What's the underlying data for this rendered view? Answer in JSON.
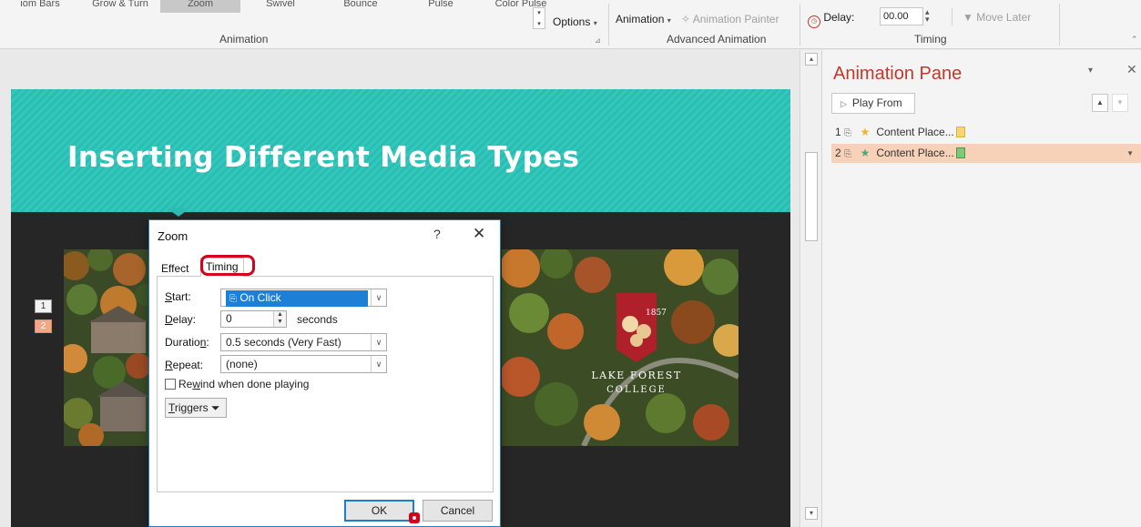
{
  "ribbon": {
    "gallery_items": [
      "iom Bars",
      "Grow & Turn",
      "Zoom",
      "Swivel",
      "Bounce",
      "Pulse",
      "Color Pulse"
    ],
    "effect_options_label": "Options",
    "animation_group_label": "Animation",
    "add_animation_label": "Animation",
    "animation_painter_label": "Animation Painter",
    "advanced_group_label": "Advanced Animation",
    "delay_label": "Delay:",
    "delay_value": "00.00",
    "move_later_label": "Move Later",
    "timing_group_label": "Timing"
  },
  "slide": {
    "title": "Inserting Different Media Types",
    "anim_tags": [
      "1",
      "2"
    ],
    "seal_year": "1857",
    "college_line1": "LAKE FOREST",
    "college_line2": "COLLEGE"
  },
  "pane": {
    "title": "Animation Pane",
    "play_from_label": "Play From",
    "items": [
      {
        "num": "1",
        "label": "Content Place...",
        "color": "#f5d76e",
        "star_color": "#f2b233"
      },
      {
        "num": "2",
        "label": "Content Place...",
        "color": "#7ec87a",
        "star_color": "#4aa87e"
      }
    ]
  },
  "dialog": {
    "title": "Zoom",
    "help": "?",
    "close": "✕",
    "tab_effect": "Effect",
    "tab_timing": "Timing",
    "start_label_prefix": "S",
    "start_label_rest": "tart:",
    "start_value": "On Click",
    "delay_label_prefix": "D",
    "delay_label_rest": "elay:",
    "delay_value": "0",
    "seconds_label": "seconds",
    "duration_label_a": "Duratio",
    "duration_label_u": "n",
    "duration_label_b": ":",
    "duration_value": "0.5 seconds (Very Fast)",
    "repeat_label_prefix": "R",
    "repeat_label_rest": "epeat:",
    "repeat_value": "(none)",
    "rewind_a": "Re",
    "rewind_u": "w",
    "rewind_b": "ind when done playing",
    "rewind_checked": false,
    "triggers_u": "T",
    "triggers_rest": "riggers",
    "ok_label": "OK",
    "cancel_label": "Cancel"
  },
  "colors": {
    "banner": "#2cbcb2",
    "pane_title": "#c0392b",
    "selected_item": "#f8d1b9",
    "highlight": "#d6001c",
    "accent": "#1e7ec8"
  }
}
